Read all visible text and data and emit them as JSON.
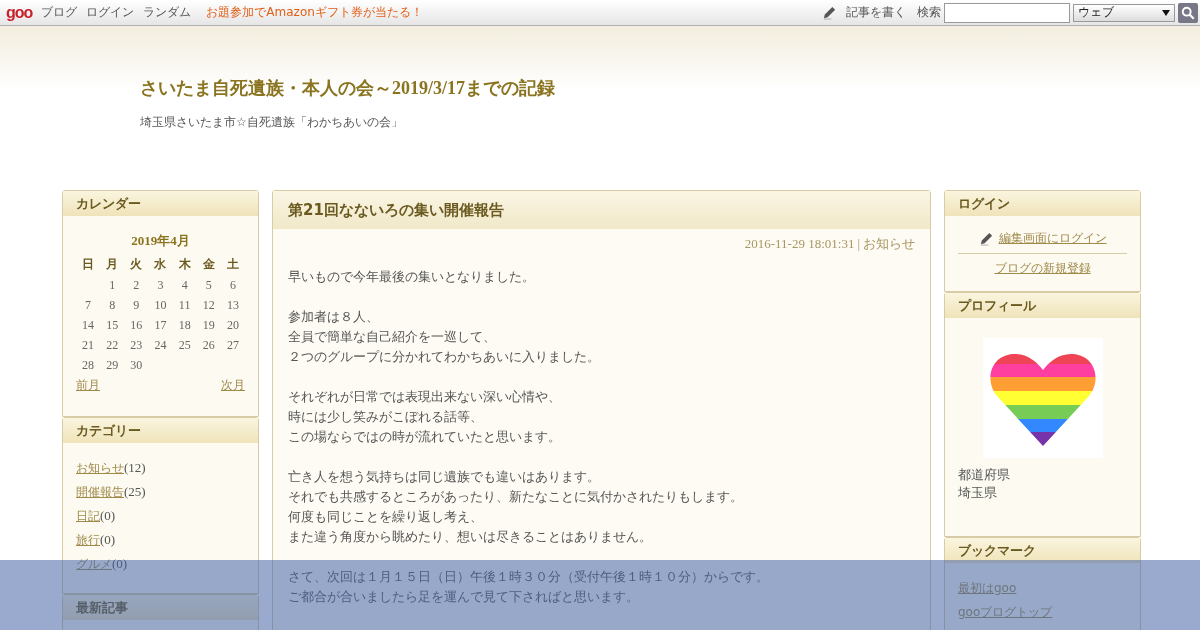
{
  "topbar": {
    "logo": "goo",
    "links": [
      "ブログ",
      "ログイン",
      "ランダム"
    ],
    "promo": "お題参加でAmazonギフト券が当たる！",
    "write": "記事を書く",
    "search_label": "検索",
    "search_scope": "ウェブ"
  },
  "header": {
    "title": "さいたま自死遺族・本人の会～2019/3/17までの記録",
    "subtitle": "埼玉県さいたま市☆自死遺族「わかちあいの会」"
  },
  "calendar": {
    "heading": "カレンダー",
    "month": "2019年4月",
    "weekdays": [
      "日",
      "月",
      "火",
      "水",
      "木",
      "金",
      "土"
    ],
    "weeks": [
      [
        {
          "kind": "blank"
        },
        {
          "kind": "day",
          "day": "1"
        },
        {
          "kind": "day",
          "day": "2"
        },
        {
          "kind": "day",
          "day": "3"
        },
        {
          "kind": "day",
          "day": "4"
        },
        {
          "kind": "day",
          "day": "5"
        },
        {
          "kind": "day",
          "day": "6"
        }
      ],
      [
        {
          "kind": "day",
          "day": "7"
        },
        {
          "kind": "day",
          "day": "8"
        },
        {
          "kind": "day",
          "day": "9"
        },
        {
          "kind": "day",
          "day": "10"
        },
        {
          "kind": "day",
          "day": "11"
        },
        {
          "kind": "day",
          "day": "12"
        },
        {
          "kind": "day",
          "day": "13"
        }
      ],
      [
        {
          "kind": "day",
          "day": "14"
        },
        {
          "kind": "day",
          "day": "15"
        },
        {
          "kind": "day",
          "day": "16"
        },
        {
          "kind": "day",
          "day": "17"
        },
        {
          "kind": "day",
          "day": "18"
        },
        {
          "kind": "day",
          "day": "19"
        },
        {
          "kind": "day",
          "day": "20"
        }
      ],
      [
        {
          "kind": "day",
          "day": "21"
        },
        {
          "kind": "day",
          "day": "22"
        },
        {
          "kind": "day",
          "day": "23"
        },
        {
          "kind": "day",
          "day": "24"
        },
        {
          "kind": "day",
          "day": "25"
        },
        {
          "kind": "day",
          "day": "26"
        },
        {
          "kind": "day",
          "day": "27"
        }
      ],
      [
        {
          "kind": "day",
          "day": "28"
        },
        {
          "kind": "day",
          "day": "29"
        },
        {
          "kind": "day",
          "day": "30"
        },
        {
          "kind": "blank"
        },
        {
          "kind": "blank"
        },
        {
          "kind": "blank"
        },
        {
          "kind": "blank"
        }
      ]
    ],
    "prev": "前月",
    "next": "次月"
  },
  "categories": {
    "heading": "カテゴリー",
    "items": [
      {
        "label": "お知らせ",
        "count": "(12)"
      },
      {
        "label": "開催報告",
        "count": "(25)"
      },
      {
        "label": "日記",
        "count": "(0)"
      },
      {
        "label": "旅行",
        "count": "(0)"
      },
      {
        "label": "グルメ",
        "count": "(0)"
      }
    ]
  },
  "recent": {
    "heading": "最新記事"
  },
  "article": {
    "title": "第21回なないろの集い開催報告",
    "date": "2016-11-29 18:01:31",
    "separator": "|",
    "category": "お知らせ",
    "paragraphs": [
      [
        "早いもので今年最後の集いとなりました。"
      ],
      [
        "参加者は８人、",
        "全員で簡単な自己紹介を一巡して、",
        "２つのグループに分かれてわかちあいに入りました。"
      ],
      [
        "それぞれが日常では表現出来ない深い心情や、",
        "時には少し笑みがこぼれる話等、",
        "この場ならではの時が流れていたと思います。"
      ],
      [
        "亡き人を想う気持ちは同じ遺族でも違いはあります。",
        "それでも共感するところがあったり、新たなことに気付かされたりもします。",
        "何度も同じことを繰り返し考え、",
        "また違う角度から眺めたり、想いは尽きることはありません。"
      ],
      [
        "さて、次回は１月１５日（日）午後１時３０分（受付午後１時１０分）からです。",
        "ご都合が合いましたら足を運んで見て下さればと思います。"
      ]
    ]
  },
  "login": {
    "heading": "ログイン",
    "edit_link": "編集画面にログイン",
    "register_link": "ブログの新規登録"
  },
  "profile": {
    "heading": "プロフィール",
    "image": {
      "kind": "picture"
    },
    "lines": [
      "都道府県",
      "埼玉県"
    ]
  },
  "bookmarks": {
    "heading": "ブックマーク",
    "links": [
      "最初はgoo",
      "gooブログトップ"
    ]
  }
}
